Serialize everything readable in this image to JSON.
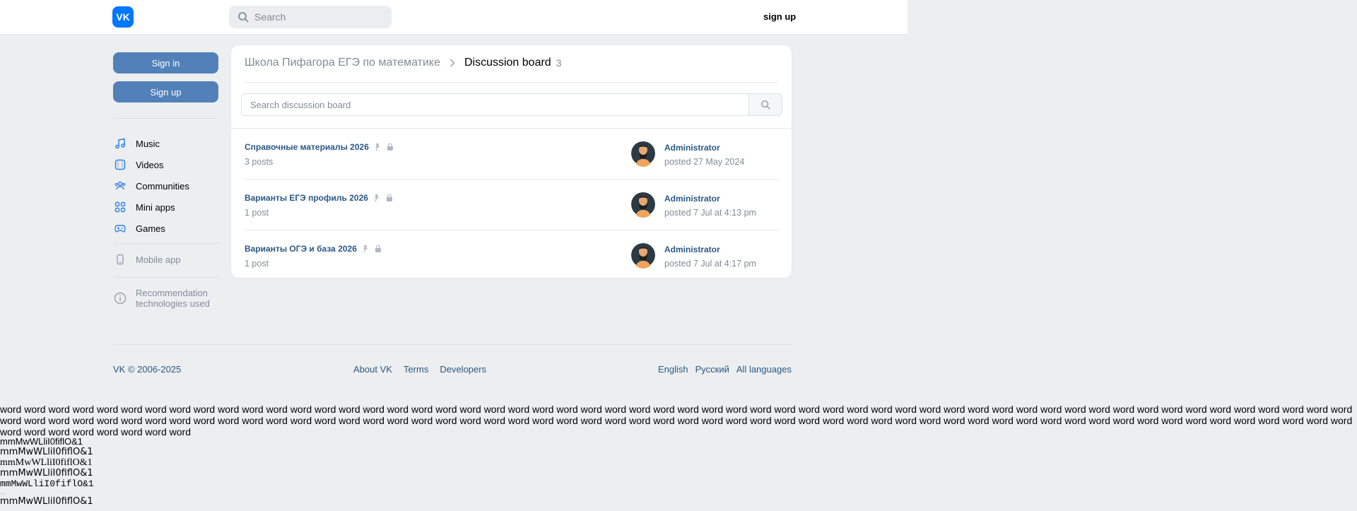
{
  "header": {
    "logo_text": "VK",
    "search_placeholder": "Search",
    "signup_label": "sign up"
  },
  "left": {
    "signin_label": "Sign in",
    "signup_label": "Sign up",
    "nav": [
      {
        "label": "Music",
        "icon": "music-icon"
      },
      {
        "label": "Videos",
        "icon": "video-icon"
      },
      {
        "label": "Communities",
        "icon": "communities-icon"
      },
      {
        "label": "Mini apps",
        "icon": "mini-apps-icon"
      },
      {
        "label": "Games",
        "icon": "gamepad-icon"
      }
    ],
    "mobile_app": "Mobile app",
    "recommend_line1": "Recommendation",
    "recommend_line2": "technologies used"
  },
  "board": {
    "group_name": "Школа Пифагора ЕГЭ по математике",
    "title": "Discussion board",
    "count": "3",
    "search_placeholder": "Search discussion board",
    "topics": [
      {
        "name": "Справочные материалы 2026",
        "posts": "3 posts",
        "author": "Administrator",
        "posted": "posted 27 May 2024"
      },
      {
        "name": "Варианты ЕГЭ профиль 2026",
        "posts": "1 post",
        "author": "Administrator",
        "posted": "posted 7 Jul at 4:13 pm"
      },
      {
        "name": "Варианты ОГЭ и база 2026",
        "posts": "1 post",
        "author": "Administrator",
        "posted": "posted 7 Jul at 4:17 pm"
      }
    ]
  },
  "footer": {
    "copyright": "VK © 2006-2025",
    "about": "About VK",
    "terms": "Terms",
    "developers": "Developers",
    "english": "English",
    "russian": "Русский",
    "all_languages": "All languages"
  },
  "test": {
    "words": "word word word word word word word word word word word word word word word word word word word word word word word word word word word word word word word word word word word word word word word word word word word word word word word word word word word word word word word word word word word word word word word word word word word word word word word word word word word word word word word word word word word word word word word word word word word word word word word word word word word word word word word word word word word word word word word word word word word word word word word word",
    "glyph1": "mmMwWLliI0fiflO&1",
    "glyph2": "mmMwWLliI0fiflO&1",
    "glyph3": "mmMwWLliI0fiflO&1",
    "glyph4": "mmMwWLliI0fiflO&1",
    "glyph5": "mmMwWLliI0fiflO&1",
    "glyph6": "...",
    "glyph7": "mmMwWLliI0fiflO&1"
  },
  "colors": {
    "accent": "#5181b8",
    "link": "#2a5885",
    "muted": "#818c99",
    "background": "#edeef0"
  }
}
